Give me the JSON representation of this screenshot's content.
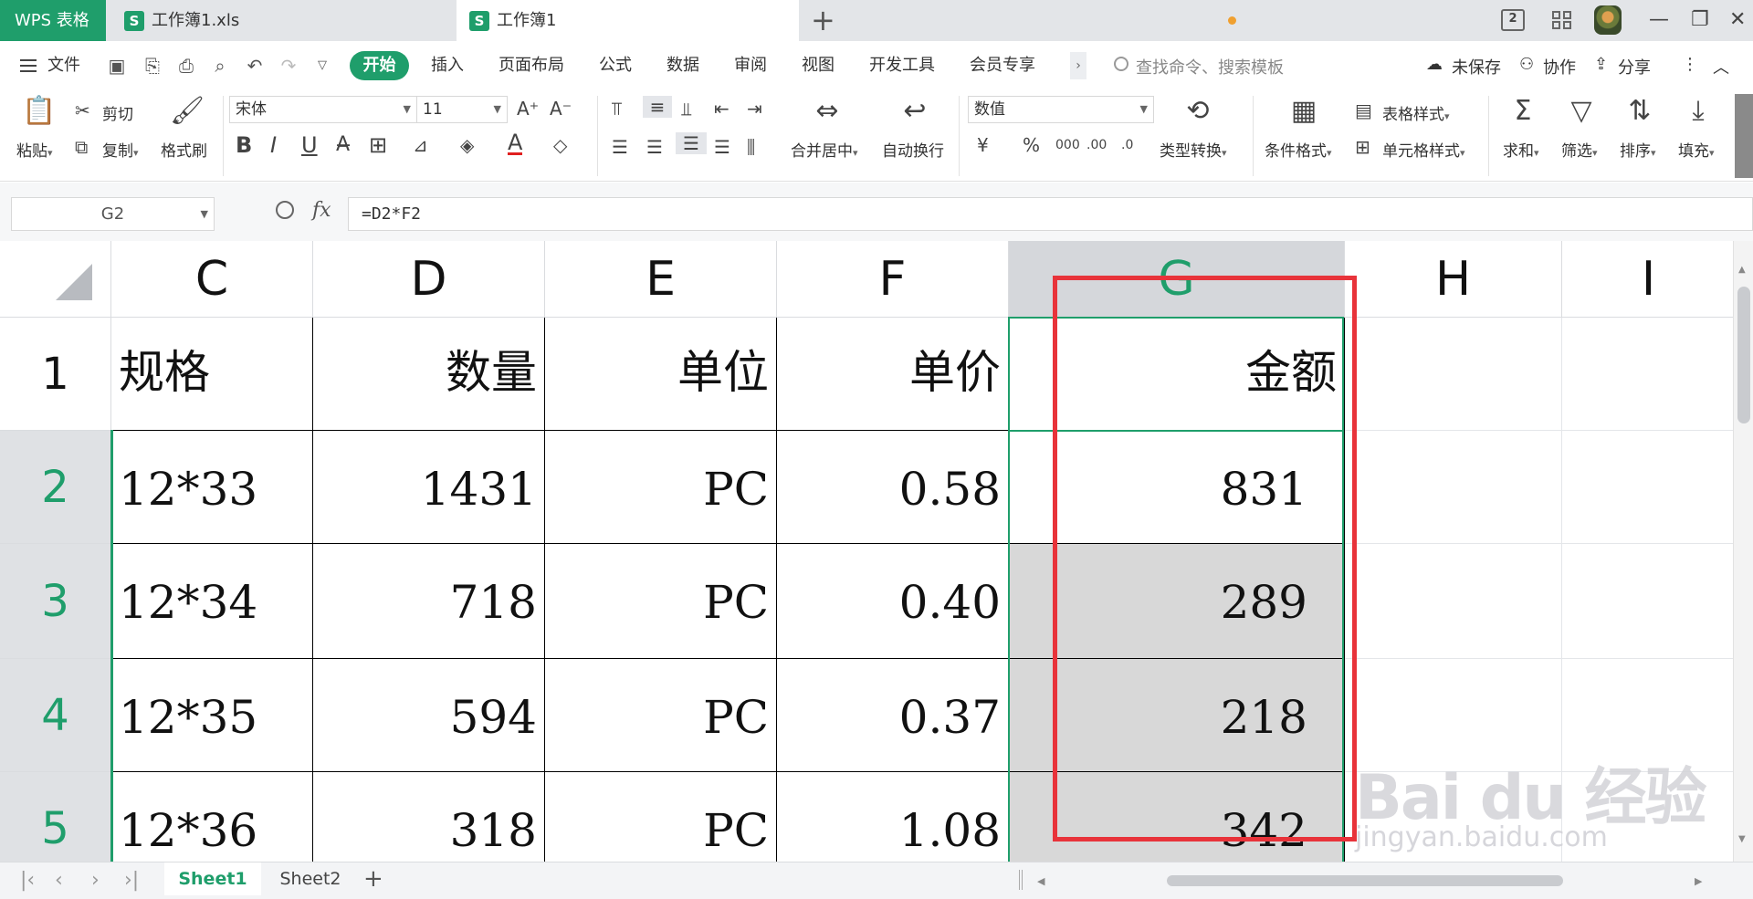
{
  "app": {
    "name": "WPS 表格",
    "tabs": [
      {
        "label": "工作簿1.xls"
      },
      {
        "label": "工作簿1"
      }
    ],
    "new_tab": "+",
    "view_badge": "2"
  },
  "menu": {
    "file": "文件",
    "items": [
      "开始",
      "插入",
      "页面布局",
      "公式",
      "数据",
      "审阅",
      "视图",
      "开发工具",
      "会员专享"
    ],
    "more": "›",
    "search_placeholder": "查找命令、搜索模板",
    "unsaved": "未保存",
    "collab": "协作",
    "share": "分享"
  },
  "ribbon": {
    "paste": "粘贴",
    "cut": "剪切",
    "copy": "复制",
    "format_painter": "格式刷",
    "font_name": "宋体",
    "font_size": "11",
    "merge_center": "合并居中",
    "wrap_text": "自动换行",
    "number_format": "数值",
    "type_convert": "类型转换",
    "conditional_format": "条件格式",
    "table_style": "表格样式",
    "cell_style": "单元格样式",
    "sum": "求和",
    "filter": "筛选",
    "sort": "排序",
    "fill": "填充"
  },
  "formula_bar": {
    "cell_ref": "G2",
    "fx": "fx",
    "formula": "=D2*F2"
  },
  "grid": {
    "columns": [
      "C",
      "D",
      "E",
      "F",
      "G",
      "H",
      "I"
    ],
    "rows": [
      {
        "num": "1",
        "cells": [
          "规格",
          "数量",
          "单位",
          "单价",
          "金额"
        ]
      },
      {
        "num": "2",
        "cells": [
          "12*33",
          "1431",
          "PC",
          "0.58",
          "831"
        ]
      },
      {
        "num": "3",
        "cells": [
          "12*34",
          "718",
          "PC",
          "0.40",
          "289"
        ]
      },
      {
        "num": "4",
        "cells": [
          "12*35",
          "594",
          "PC",
          "0.37",
          "218"
        ]
      },
      {
        "num": "5",
        "cells": [
          "12*36",
          "318",
          "PC",
          "1.08",
          "342"
        ]
      }
    ]
  },
  "sheets": {
    "tabs": [
      "Sheet1",
      "Sheet2"
    ],
    "add": "+"
  },
  "watermark": {
    "brand": "Bai du 经验",
    "url": "jingyan.baidu.com"
  },
  "colors": {
    "accent": "#1f9e6b",
    "annotation": "#e8333a"
  }
}
